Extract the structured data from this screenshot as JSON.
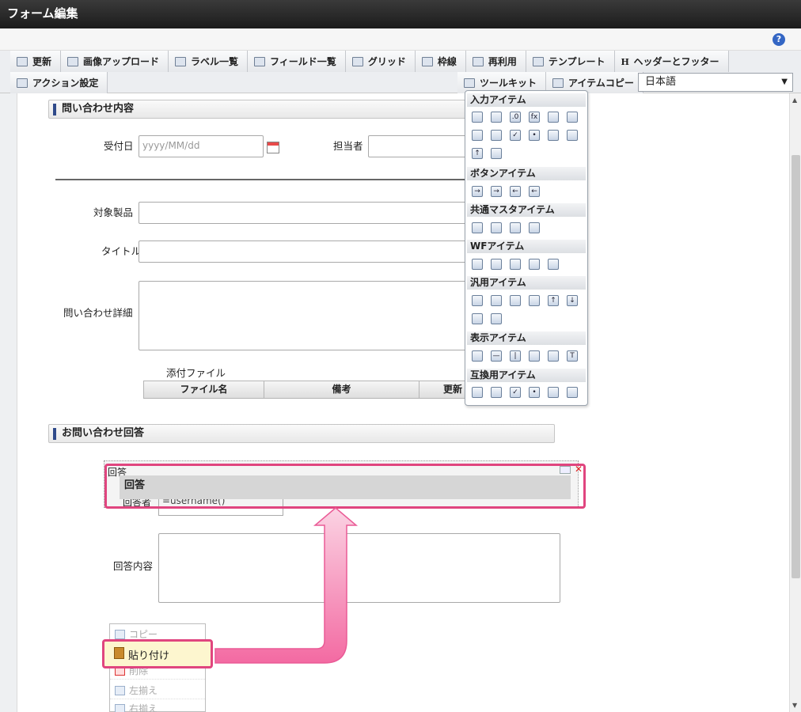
{
  "window": {
    "title": "フォーム編集"
  },
  "toolbar": {
    "row1": [
      {
        "label": "更新",
        "icon": "refresh-icon"
      },
      {
        "label": "画像アップロード",
        "icon": "image-upload-icon"
      },
      {
        "label": "ラベル一覧",
        "icon": "label-list-icon"
      },
      {
        "label": "フィールド一覧",
        "icon": "field-list-icon"
      },
      {
        "label": "グリッド",
        "icon": "grid-icon"
      },
      {
        "label": "枠線",
        "icon": "border-icon"
      },
      {
        "label": "再利用",
        "icon": "reuse-icon"
      },
      {
        "label": "テンプレート",
        "icon": "template-icon"
      },
      {
        "label": "ヘッダーとフッター",
        "icon": "header-footer-icon"
      }
    ],
    "row2": [
      {
        "label": "アクション設定",
        "icon": "action-icon"
      }
    ],
    "row2_right": [
      {
        "label": "ツールキット",
        "icon": "toolkit-icon"
      },
      {
        "label": "アイテムコピー",
        "icon": "item-copy-icon"
      }
    ],
    "language": "日本語"
  },
  "form": {
    "section1": "問い合わせ内容",
    "received_date_label": "受付日",
    "received_date_placeholder": "yyyy/MM/dd",
    "assignee_label": "担当者",
    "product_label": "対象製品",
    "title_label": "タイトル",
    "detail_label": "問い合わせ詳細",
    "attachment_label": "添付ファイル",
    "attachment_columns": [
      "ファイル名",
      "備考",
      "更新"
    ],
    "section2": "お問い合わせ回答",
    "answer_small_label": "回答",
    "answer_banner": "回答",
    "answerer_label": "回答者",
    "answerer_value": "=username()",
    "answer_content_label": "回答内容"
  },
  "context_menu": {
    "items": [
      "コピー",
      "貼り付け",
      "削除",
      "左揃え",
      "右揃え"
    ]
  },
  "toolkit": {
    "categories": [
      {
        "name": "入力アイテム",
        "icons": [
          "textbox-icon",
          "textbox-wide-icon",
          "number-icon",
          "formula-icon",
          "date-icon",
          "datetime-icon",
          "select-icon",
          "list-icon",
          "checkbox-icon",
          "radio-icon",
          "listbox-icon",
          "listbox-multi-icon",
          "upload-icon",
          "table-icon"
        ]
      },
      {
        "name": "ボタンアイテム",
        "icons": [
          "submit-button-icon",
          "next-button-icon",
          "back-button-icon",
          "prev-button-icon"
        ]
      },
      {
        "name": "共通マスタアイテム",
        "icons": [
          "user-icon",
          "organization-icon",
          "role-icon",
          "group-icon"
        ]
      },
      {
        "name": "WFアイテム",
        "icons": [
          "clipboard-icon",
          "attachment-icon",
          "image-icon",
          "history-icon",
          "stamp-icon"
        ]
      },
      {
        "name": "汎用アイテム",
        "icons": [
          "hidden-icon",
          "document-icon",
          "camera-icon",
          "lookup-icon",
          "file-upload-icon",
          "file-download-icon",
          "panel-icon",
          "map-icon"
        ]
      },
      {
        "name": "表示アイテム",
        "icons": [
          "label-icon",
          "hline-icon",
          "vline-icon",
          "box-icon",
          "picture-icon",
          "text-icon"
        ]
      },
      {
        "name": "互換用アイテム",
        "icons": [
          "select-compat-icon",
          "table-compat-icon",
          "checkbox-compat-icon",
          "radio-compat-icon",
          "listbox-compat-icon",
          "listbox-multi-compat-icon"
        ]
      }
    ]
  },
  "colors": {
    "highlight": "#e0457f",
    "title_bar": "#2a2a2a",
    "section_accent": "#2f4a8a"
  }
}
